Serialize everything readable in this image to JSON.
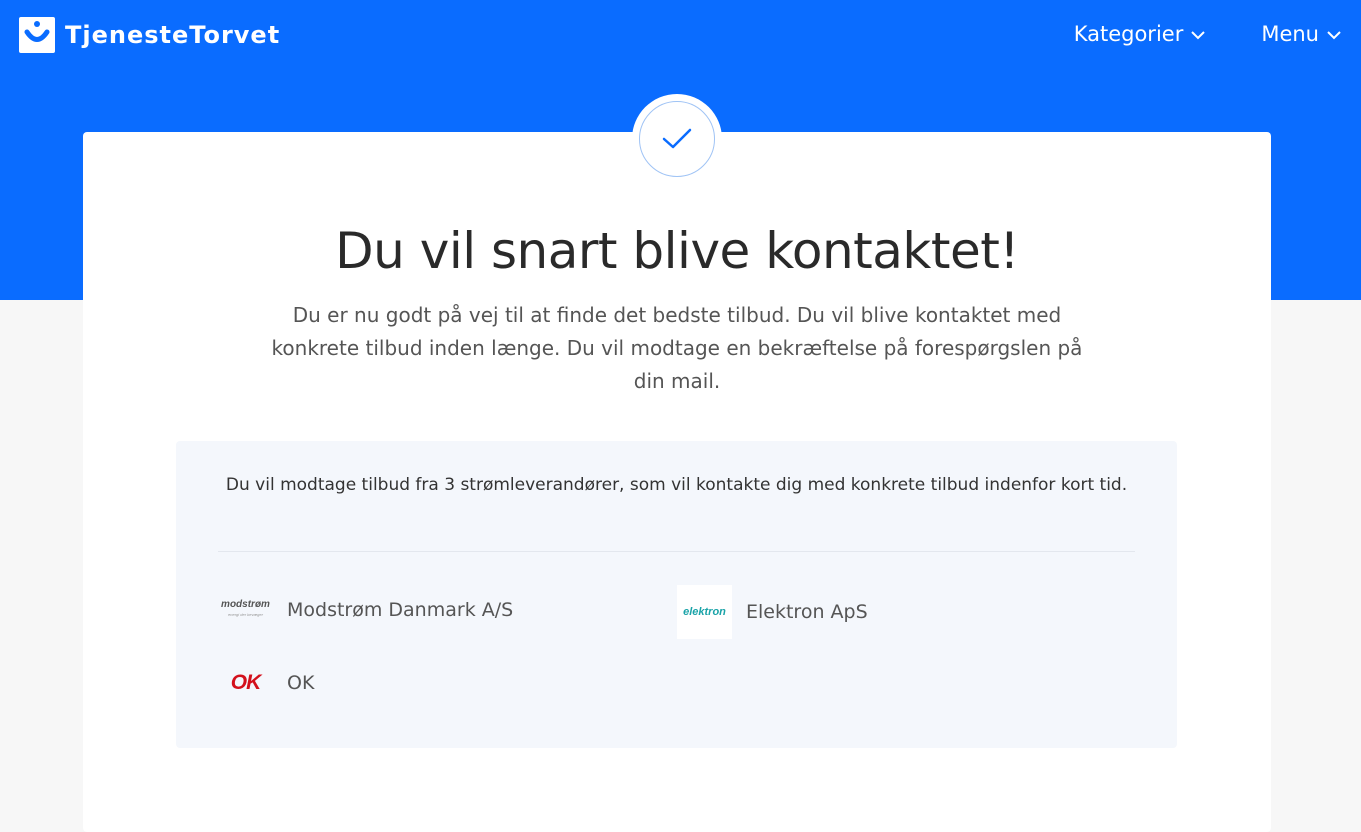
{
  "header": {
    "brand": "TjenesteTorvet",
    "nav": [
      {
        "label": "Kategorier",
        "icon": "chevron-down-icon"
      },
      {
        "label": "Menu",
        "icon": "chevron-down-icon"
      }
    ]
  },
  "confirmation": {
    "icon": "checkmark-icon",
    "title": "Du vil snart blive kontaktet!",
    "message": "Du er nu godt på vej til at finde det bedste tilbud. Du vil blive kontaktet med konkrete tilbud inden længe. Du vil modtage en bekræftelse på forespørgslen på din mail."
  },
  "suppliers_panel": {
    "intro": "Du vil modtage tilbud fra 3 strømleverandører, som vil kontakte dig med konkrete tilbud indenfor kort tid.",
    "suppliers": [
      {
        "name": "Modstrøm Danmark A/S",
        "logo_text": "modstrøm",
        "logo_subtext": "energi der bevæger"
      },
      {
        "name": "Elektron ApS",
        "logo_text": "elektron"
      },
      {
        "name": "OK",
        "logo_text": "OK"
      }
    ]
  },
  "colors": {
    "brand_blue": "#0a6cff",
    "panel_bg": "#f4f7fc",
    "ok_red": "#d3101c",
    "elektron_teal": "#1aa3a8"
  }
}
